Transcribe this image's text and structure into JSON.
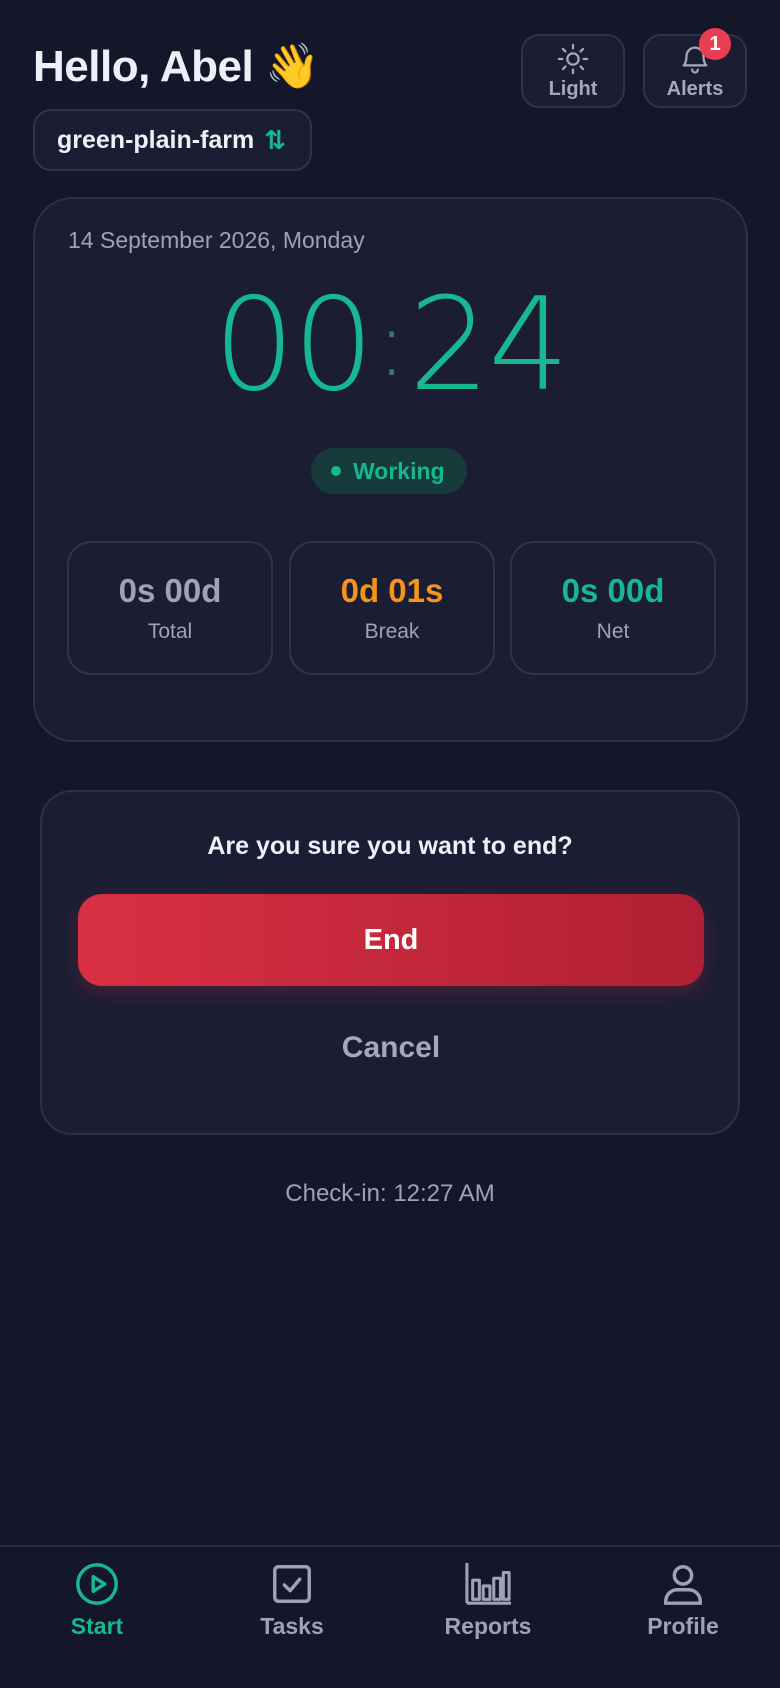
{
  "header": {
    "greeting": "Hello, Abel 👋",
    "farm_name": "green-plain-farm",
    "swap_icon": "⇅",
    "light_label": "Light",
    "alerts_label": "Alerts",
    "alerts_count": "1"
  },
  "timer": {
    "date": "14 September 2026, Monday",
    "hours": "00",
    "separator": ":",
    "minutes": "24",
    "status": "Working",
    "stats": {
      "total": {
        "value": "0s 00d",
        "label": "Total"
      },
      "break": {
        "value": "0d 01s",
        "label": "Break"
      },
      "net": {
        "value": "0s 00d",
        "label": "Net"
      }
    }
  },
  "confirm": {
    "question": "Are you sure you want to end?",
    "end_label": "End",
    "cancel_label": "Cancel"
  },
  "checkin": "Check-in: 12:27 AM",
  "nav": {
    "start": "Start",
    "tasks": "Tasks",
    "reports": "Reports",
    "profile": "Profile"
  },
  "colors": {
    "accent": "#17b890",
    "break": "#f4941c",
    "danger": "#d93043",
    "background": "#14172a"
  }
}
